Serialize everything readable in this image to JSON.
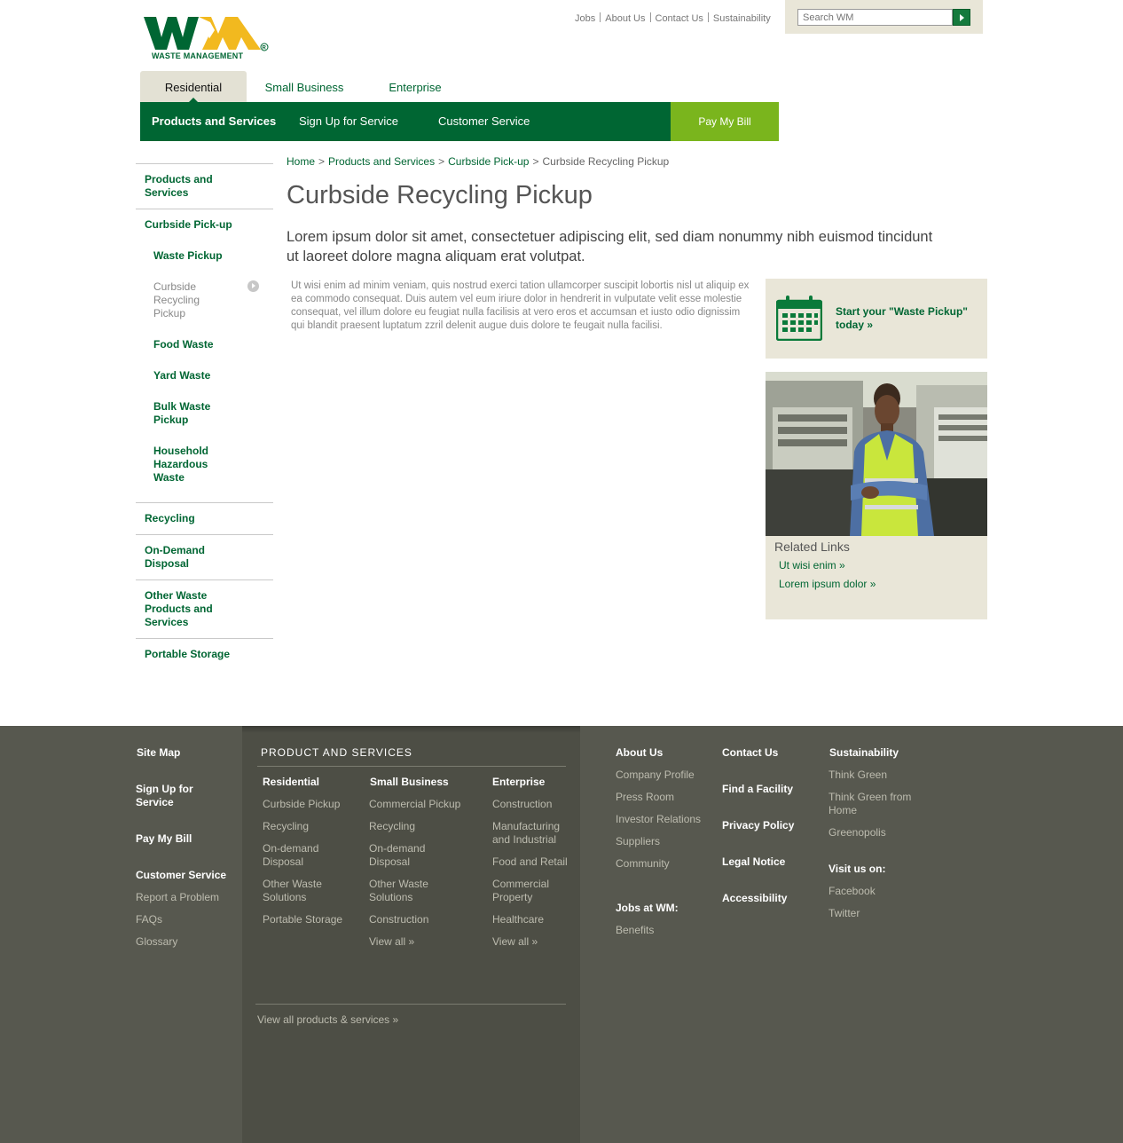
{
  "brand": {
    "logo_alt": "WM",
    "logo_name": "WASTE MANAGEMENT",
    "colors": {
      "green": "#006633",
      "lime": "#7ab51d",
      "tan": "#e9e6d8",
      "footer": "#57584f"
    }
  },
  "utility_links": [
    "Jobs",
    "About Us",
    "Contact Us",
    "Sustainability"
  ],
  "search": {
    "placeholder": "Search WM"
  },
  "segment_tabs": [
    "Residential",
    "Small Business",
    "Enterprise"
  ],
  "main_nav": {
    "items": [
      "Products and Services",
      "Sign Up for Service",
      "Customer Service"
    ],
    "pay_bill": "Pay My Bill"
  },
  "sidebar": {
    "products_and_services": "Products and Services",
    "curbside_pickup": "Curbside Pick-up",
    "sub": [
      "Waste Pickup",
      "Curbside Recycling Pickup",
      "Food Waste",
      "Yard Waste",
      "Bulk Waste Pickup",
      "Household Hazardous Waste"
    ],
    "recycling": "Recycling",
    "on_demand": "On-Demand Disposal",
    "other": "Other Waste Products and Services",
    "portable": "Portable Storage"
  },
  "breadcrumb": [
    "Home",
    "Products and Services",
    "Curbside Pick-up",
    "Curbside Recycling Pickup"
  ],
  "page_title": "Curbside Recycling Pickup",
  "intro": "Lorem ipsum dolor sit amet, consectetuer adipiscing elit, sed diam nonummy nibh euismod tincidunt ut laoreet dolore magna aliquam erat volutpat.",
  "body": "Ut wisi enim ad minim veniam, quis nostrud exerci tation ullamcorper suscipit lobortis nisl ut aliquip ex ea commodo consequat. Duis autem vel eum iriure dolor in hendrerit in vulputate velit esse molestie consequat, vel illum dolore eu feugiat nulla facilisis at vero eros et accumsan et iusto odio dignissim qui blandit praesent luptatum zzril delenit augue duis dolore te feugait nulla facilisi.",
  "promo": {
    "link": "Start your \"Waste Pickup\" today »"
  },
  "related": {
    "title": "Related Links",
    "links": [
      "Ut wisi enim »",
      "Lorem ipsum dolor »"
    ]
  },
  "footer": {
    "left": {
      "site_map": "Site Map",
      "sign_up": "Sign Up for Service",
      "pay_bill": "Pay My Bill",
      "customer_service": "Customer Service",
      "cs_links": [
        "Report a Problem",
        "FAQs",
        "Glossary"
      ]
    },
    "products": {
      "title": "PRODUCT AND SERVICES",
      "residential": {
        "head": "Residential",
        "links": [
          "Curbside Pickup",
          "Recycling",
          "On-demand Disposal",
          "Other Waste Solutions",
          "Portable Storage"
        ]
      },
      "small_business": {
        "head": "Small Business",
        "links": [
          "Commercial Pickup",
          "Recycling",
          "On-demand Disposal",
          "Other Waste Solutions",
          "Construction",
          "View all »"
        ]
      },
      "enterprise": {
        "head": "Enterprise",
        "links": [
          "Construction",
          "Manufacturing and Industrial",
          "Food and Retail",
          "Commercial Property",
          "Healthcare",
          "View all »"
        ]
      },
      "view_all": "View all products & services »"
    },
    "about": {
      "head": "About Us",
      "links": [
        "Company Profile",
        "Press Room",
        "Investor Relations",
        "Suppliers",
        "Community"
      ],
      "jobs_head": "Jobs at WM:",
      "jobs_links": [
        "Benefits"
      ]
    },
    "contact": [
      "Contact Us",
      "Find a Facility",
      "Privacy Policy",
      "Legal Notice",
      "Accessibility"
    ],
    "sustainability": {
      "head": "Sustainability",
      "links": [
        "Think Green",
        "Think Green from Home",
        "Greenopolis"
      ],
      "visit_head": "Visit us on:",
      "social": [
        "Facebook",
        "Twitter"
      ]
    }
  }
}
